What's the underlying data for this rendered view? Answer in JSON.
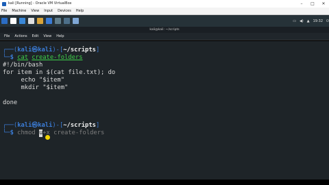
{
  "vbox": {
    "title": "kali [Running] - Oracle VM VirtualBox",
    "menu": [
      "File",
      "Machine",
      "View",
      "Input",
      "Devices",
      "Help"
    ]
  },
  "panel": {
    "time": "19:32",
    "icon_colors": [
      "#2b6cc4",
      "#ffffff",
      "#3a88d8",
      "#e0e0e0",
      "#d9a43a",
      "#3a7bd5",
      "#607d8b",
      "#4d6f89",
      "#7fa7d6"
    ]
  },
  "terminal": {
    "title": "kali@kali: ~/scripts",
    "menu": [
      "File",
      "Actions",
      "Edit",
      "View",
      "Help"
    ],
    "prompt": {
      "user": "kali",
      "at": "㉿",
      "host": "kali",
      "dir": "~/scripts",
      "dollar": "$"
    },
    "cmd1": "cat",
    "cmd1_arg": "create-folders",
    "script_lines": [
      "#!/bin/bash",
      "for item in $(cat file.txt); do",
      "     echo \"$item\"",
      "     mkdir \"$item\""
    ],
    "done": "done",
    "cmd2": "chmod",
    "cmd2_cursor": "u",
    "cmd2_rest": "+x create-folders"
  }
}
